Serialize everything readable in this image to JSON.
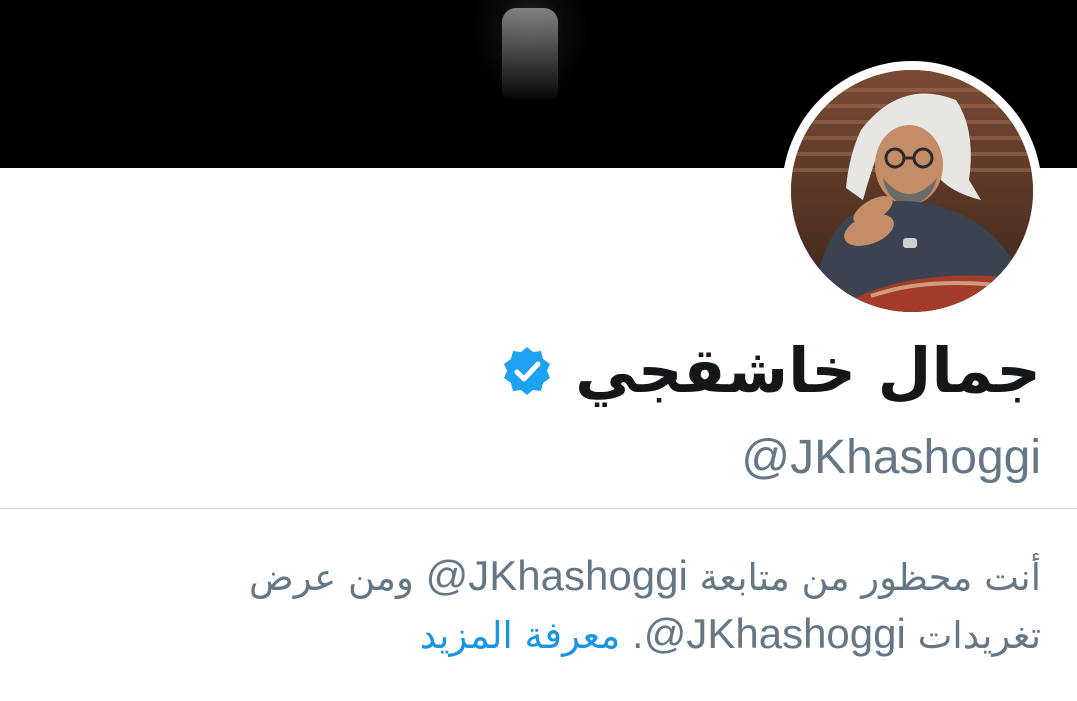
{
  "profile": {
    "display_name": "جمال خاشقجي",
    "handle": "@JKhashoggi",
    "verified": true
  },
  "notice": {
    "line1_part1": "أنت محظور من متابعة ",
    "line1_mention": "@JKhashoggi",
    "line1_part2": " ومن عرض",
    "line2_part1": "تغريدات ",
    "line2_mention": "@JKhashoggi",
    "line2_part2": ". ",
    "learn_more": "معرفة المزيد"
  },
  "colors": {
    "banner": "#000000",
    "name": "#14171a",
    "secondary_text": "#657786",
    "link": "#1b95e0",
    "verified_badge": "#1da1f2"
  },
  "icons": {
    "verified_badge": "verified-badge-icon"
  }
}
